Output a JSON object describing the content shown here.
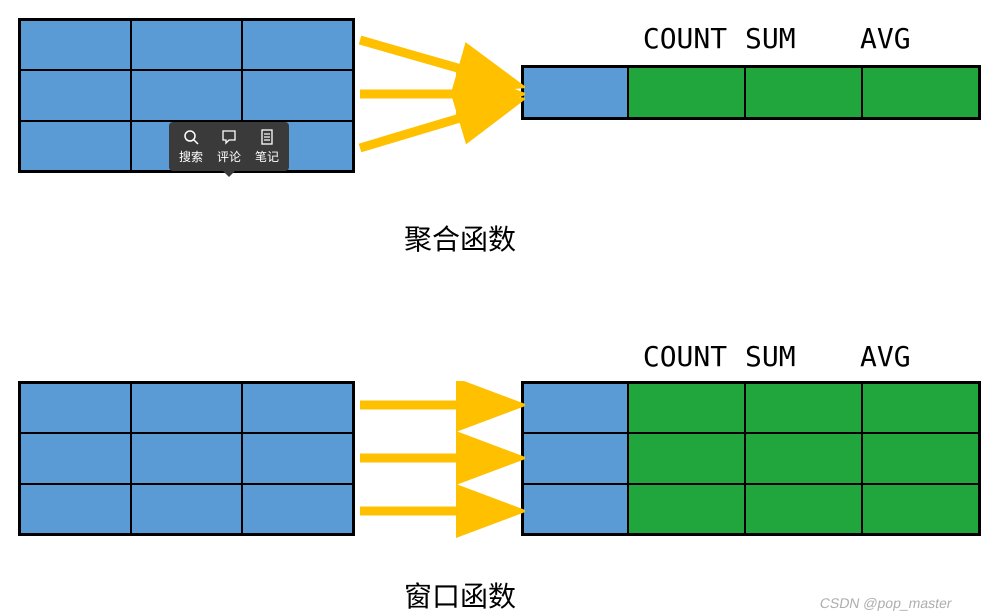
{
  "diagram": {
    "section1": {
      "headers": {
        "count": "COUNT",
        "sum": "SUM",
        "avg": "AVG"
      },
      "caption": "聚合函数"
    },
    "section2": {
      "headers": {
        "count": "COUNT",
        "sum": "SUM",
        "avg": "AVG"
      },
      "caption": "窗口函数"
    }
  },
  "tooltip": {
    "search": "搜索",
    "comment": "评论",
    "note": "笔记"
  },
  "watermark": "CSDN @pop_master",
  "colors": {
    "blue": "#5b9bd5",
    "green": "#21a53d",
    "arrow": "#ffc000",
    "tooltip_bg": "#3a3a3a"
  },
  "chart_data": [
    {
      "type": "diagram",
      "name": "aggregate_function",
      "label": "聚合函数",
      "input_rows": 3,
      "input_cols": 3,
      "output_rows": 1,
      "output_key_cols": 1,
      "output_value_cols": [
        "COUNT",
        "SUM",
        "AVG"
      ],
      "description": "Many input rows reduce to one output row with aggregate columns"
    },
    {
      "type": "diagram",
      "name": "window_function",
      "label": "窗口函数",
      "input_rows": 3,
      "input_cols": 3,
      "output_rows": 3,
      "output_key_cols": 1,
      "output_value_cols": [
        "COUNT",
        "SUM",
        "AVG"
      ],
      "description": "Each input row maps to one output row with additional window-aggregate columns"
    }
  ]
}
